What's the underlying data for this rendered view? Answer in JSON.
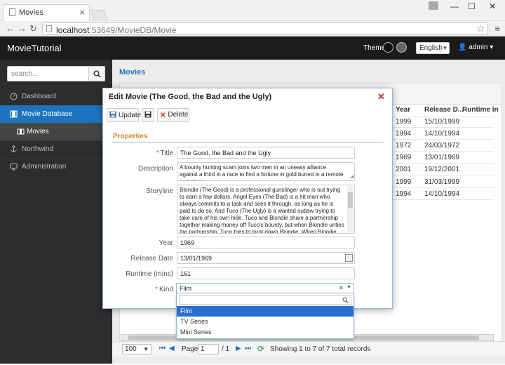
{
  "browser": {
    "tab_title": "Movies",
    "url_host": "localhost",
    "url_rest": ":53649/MovieDB/Movie"
  },
  "header": {
    "brand": "MovieTutorial",
    "theme_label": "Theme",
    "language": "English",
    "user": "admin"
  },
  "sidebar": {
    "search_placeholder": "search...",
    "items": [
      {
        "label": "Dashboard",
        "icon": "dashboard-icon"
      },
      {
        "label": "Movie Database",
        "icon": "film-icon"
      },
      {
        "label": "Movies",
        "icon": "film-icon"
      },
      {
        "label": "Northwind",
        "icon": "anchor-icon"
      },
      {
        "label": "Administration",
        "icon": "monitor-icon"
      }
    ]
  },
  "main": {
    "title": "Movies",
    "columns": [
      "Year",
      "Release D...",
      "Runtime in"
    ],
    "rows": [
      {
        "year": "1999",
        "release": "15/10/1999"
      },
      {
        "year": "1994",
        "release": "14/10/1994"
      },
      {
        "year": "1972",
        "release": "24/03/1972"
      },
      {
        "year": "1969",
        "release": "13/01/1969"
      },
      {
        "year": "2001",
        "release": "19/12/2001"
      },
      {
        "year": "1999",
        "release": "31/03/1999"
      },
      {
        "year": "1994",
        "release": "14/10/1994"
      }
    ]
  },
  "pager": {
    "page_size": "100",
    "page_label": "Page",
    "page_number": "1",
    "of_label": "/ 1",
    "status": "Showing 1 to 7 of 7 total records"
  },
  "dialog": {
    "title": "Edit Movie (The Good, the Bad and the Ugly)",
    "update_label": "Update",
    "delete_label": "Delete",
    "section": "Properties",
    "fields": {
      "title_label": "Title",
      "title_value": "The Good, the Bad and the Ugly",
      "description_label": "Description",
      "description_value": "A bounty hunting scam joins two men in an uneasy alliance against a third in a race to find a fortune in gold buried in a remote cemetery.",
      "storyline_label": "Storyline",
      "storyline_value": "Blondie (The Good) is a professional gunslinger who is out trying to earn a few dollars. Angel Eyes (The Bad) is a hit man who always commits to a task and sees it through, as long as he is paid to do so. And Tuco (The Ugly) is a wanted outlaw trying to take care of his own hide. Tuco and Blondie share a partnership together making money off Tuco's bounty, but when Blondie unties the partnership, Tuco tries to hunt down Blondie. When Blondie and Tuco come across a horse carriage loaded with dead bodies, they soon learn from the only survivor (Bill Carson) that he and a few other men have buried",
      "year_label": "Year",
      "year_value": "1969",
      "release_label": "Release Date",
      "release_value": "13/01/1969",
      "runtime_label": "Runtime (mins)",
      "runtime_value": "161",
      "kind_label": "Kind",
      "kind_value": "Film"
    },
    "kind_options": [
      "Film",
      "TV Series",
      "Mini Series"
    ]
  },
  "colors": {
    "accent": "#1e73be",
    "header_bg": "#1b1b1b",
    "sidebar_bg": "#2d2d2d",
    "section_title": "#d4862b",
    "required": "#d9534f",
    "highlight_option": "#2a6fcf"
  }
}
